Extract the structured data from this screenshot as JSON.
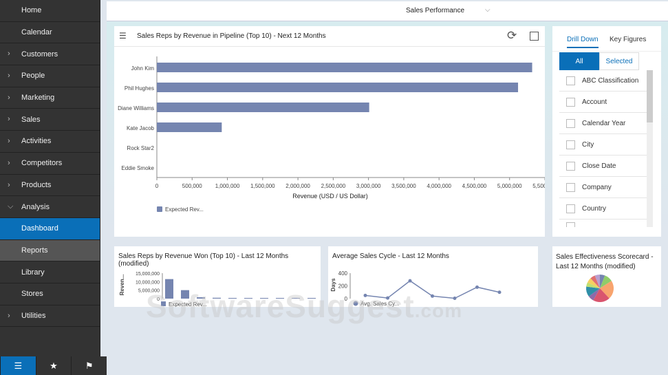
{
  "sidebar": {
    "items": [
      {
        "label": "Home",
        "chevron": false
      },
      {
        "label": "Calendar",
        "chevron": false
      },
      {
        "label": "Customers",
        "chevron": true
      },
      {
        "label": "People",
        "chevron": true
      },
      {
        "label": "Marketing",
        "chevron": true
      },
      {
        "label": "Sales",
        "chevron": true
      },
      {
        "label": "Activities",
        "chevron": true
      },
      {
        "label": "Competitors",
        "chevron": true
      },
      {
        "label": "Products",
        "chevron": true
      },
      {
        "label": "Analysis",
        "chevron": true,
        "expanded": true
      },
      {
        "label": "Dashboard",
        "state": "active"
      },
      {
        "label": "Reports",
        "state": "selected"
      },
      {
        "label": "Library"
      },
      {
        "label": "Stores"
      },
      {
        "label": "Utilities",
        "chevron": true
      }
    ],
    "bottom": [
      {
        "icon": "menu-icon",
        "glyph": "☰"
      },
      {
        "icon": "star-icon",
        "glyph": "★"
      },
      {
        "icon": "flag-icon",
        "glyph": "⚑"
      }
    ]
  },
  "header": {
    "title": "Sales Performance",
    "dropdown_glyph": "⌵"
  },
  "watermark": {
    "text": "SoftwareSuggest",
    ".com": ".com",
    "suffix": ".com"
  },
  "colors": {
    "accent": "#0a6fb8",
    "bar": "#7585b0",
    "sidebar": "#333333"
  },
  "chart_data": [
    {
      "type": "bar",
      "orientation": "horizontal",
      "title": "Sales Reps by Revenue in Pipeline (Top 10) - Next 12 Months",
      "categories": [
        "John Kim",
        "Phil Hughes",
        "Diane Williams",
        "Kate Jacob",
        "Rock Star2",
        "Eddie Smoke"
      ],
      "values": [
        5320000,
        5120000,
        3010000,
        920000,
        0,
        0
      ],
      "xlabel": "Revenue (USD / US Dollar)",
      "xlim": [
        0,
        5500000
      ],
      "ticks": [
        "0",
        "500,000",
        "1,000,000",
        "1,500,000",
        "2,000,000",
        "2,500,000",
        "3,000,000",
        "3,500,000",
        "4,000,000",
        "4,500,000",
        "5,000,000",
        "5,500,000"
      ],
      "legend": "Expected Rev...",
      "legend_position": "bottom-left"
    },
    {
      "type": "bar",
      "title": "Sales Reps by Revenue Won (Top 10) - Last 12 Months (modified)",
      "values": [
        11500000,
        5000000,
        800000,
        500000,
        0,
        0,
        0,
        0,
        0,
        0
      ],
      "ylabel": "Reven...",
      "ylim": [
        0,
        15000000
      ],
      "ticks": [
        "15,000,000",
        "10,000,000",
        "5,000,000",
        "0"
      ],
      "legend": "Expected Rev..."
    },
    {
      "type": "line",
      "title": "Average Sales Cycle - Last 12 Months",
      "values": [
        50,
        10,
        280,
        40,
        5,
        180,
        100
      ],
      "ylabel": "Days",
      "ylim": [
        0,
        400
      ],
      "ticks": [
        "400",
        "200",
        "0"
      ],
      "legend": "Avg. Sales Cy..."
    },
    {
      "type": "pie",
      "title": "Sales Effectiveness Scorecard - Last 12 Months (modified)",
      "values": [
        6,
        10,
        22,
        20,
        7,
        12,
        5,
        6,
        6,
        6
      ],
      "colors": [
        "#7585b0",
        "#8fcc6a",
        "#f8a46e",
        "#d9556e",
        "#8e6aa8",
        "#2f8fa8",
        "#c0e070",
        "#f4d060",
        "#e07070",
        "#b8a0d0"
      ]
    }
  ],
  "drill": {
    "tabs": [
      "Drill Down",
      "Key Figures"
    ],
    "segments": [
      "All",
      "Selected"
    ],
    "items": [
      "ABC Classification",
      "Account",
      "Calendar Year",
      "City",
      "Close Date",
      "Company",
      "Country"
    ]
  }
}
